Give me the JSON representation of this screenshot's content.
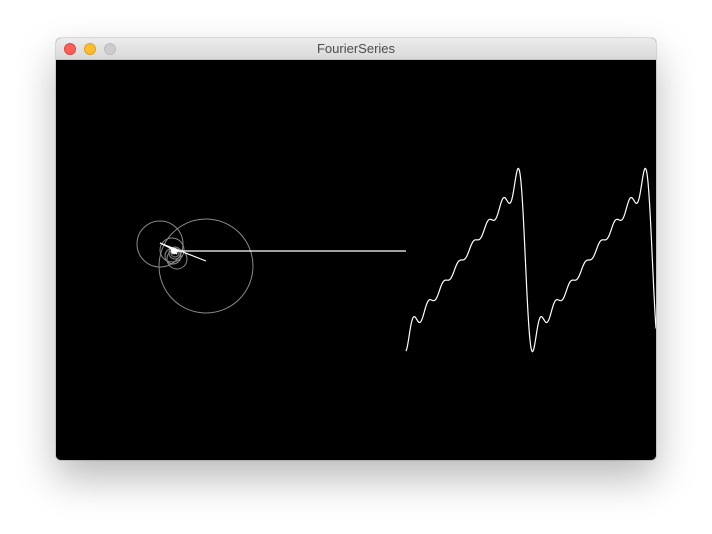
{
  "window": {
    "title": "FourierSeries",
    "buttons": {
      "close_color": "#fe5f57",
      "minimize_color": "#febc2e",
      "zoom_color": "#cccccc"
    }
  },
  "canvas": {
    "background": "#000000",
    "stroke_color": "#ffffff",
    "circle_color": "#8a8a8a"
  }
}
